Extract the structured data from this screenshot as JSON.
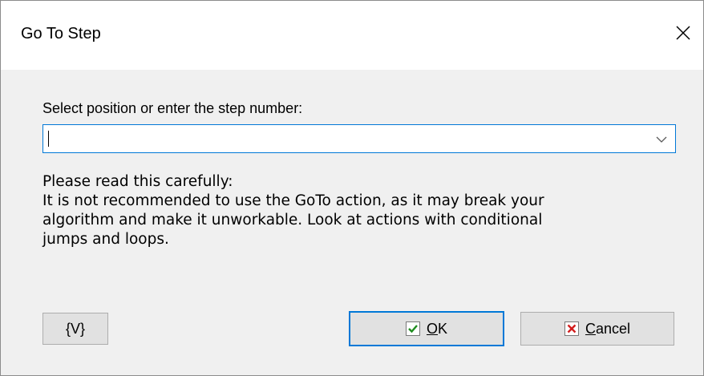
{
  "window": {
    "title": "Go To Step",
    "close_icon": "close-icon"
  },
  "step_field": {
    "label": "Select position or enter the step number:",
    "value": "",
    "dropdown_icon": "chevron-down-icon"
  },
  "notice": {
    "lines": [
      "Please read this carefully:",
      "It is not recommended to use the GoTo action, as it may break your",
      "algorithm and make it unworkable. Look at actions with conditional",
      "jumps and loops."
    ]
  },
  "buttons": {
    "variables_label": "{V}",
    "ok_label": "OK",
    "ok_icon": "checkmark-icon",
    "cancel_label": "Cancel",
    "cancel_icon": "x-mark-icon"
  },
  "colors": {
    "focus_border": "#0078d7",
    "ok_check": "#1e8c1e",
    "cancel_x": "#d21e1e",
    "dialog_bg": "#f0f0f0"
  }
}
